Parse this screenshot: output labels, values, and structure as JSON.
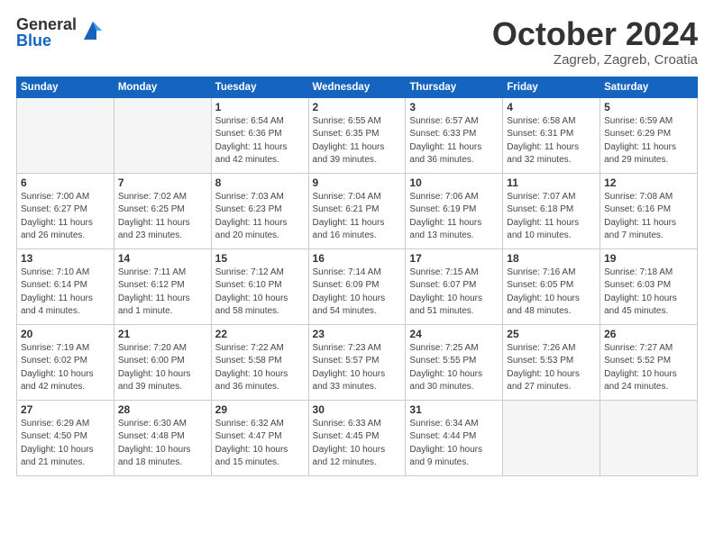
{
  "header": {
    "logo_general": "General",
    "logo_blue": "Blue",
    "month_title": "October 2024",
    "location": "Zagreb, Zagreb, Croatia"
  },
  "calendar": {
    "days_of_week": [
      "Sunday",
      "Monday",
      "Tuesday",
      "Wednesday",
      "Thursday",
      "Friday",
      "Saturday"
    ],
    "weeks": [
      [
        {
          "day": "",
          "info": ""
        },
        {
          "day": "",
          "info": ""
        },
        {
          "day": "1",
          "info": "Sunrise: 6:54 AM\nSunset: 6:36 PM\nDaylight: 11 hours\nand 42 minutes."
        },
        {
          "day": "2",
          "info": "Sunrise: 6:55 AM\nSunset: 6:35 PM\nDaylight: 11 hours\nand 39 minutes."
        },
        {
          "day": "3",
          "info": "Sunrise: 6:57 AM\nSunset: 6:33 PM\nDaylight: 11 hours\nand 36 minutes."
        },
        {
          "day": "4",
          "info": "Sunrise: 6:58 AM\nSunset: 6:31 PM\nDaylight: 11 hours\nand 32 minutes."
        },
        {
          "day": "5",
          "info": "Sunrise: 6:59 AM\nSunset: 6:29 PM\nDaylight: 11 hours\nand 29 minutes."
        }
      ],
      [
        {
          "day": "6",
          "info": "Sunrise: 7:00 AM\nSunset: 6:27 PM\nDaylight: 11 hours\nand 26 minutes."
        },
        {
          "day": "7",
          "info": "Sunrise: 7:02 AM\nSunset: 6:25 PM\nDaylight: 11 hours\nand 23 minutes."
        },
        {
          "day": "8",
          "info": "Sunrise: 7:03 AM\nSunset: 6:23 PM\nDaylight: 11 hours\nand 20 minutes."
        },
        {
          "day": "9",
          "info": "Sunrise: 7:04 AM\nSunset: 6:21 PM\nDaylight: 11 hours\nand 16 minutes."
        },
        {
          "day": "10",
          "info": "Sunrise: 7:06 AM\nSunset: 6:19 PM\nDaylight: 11 hours\nand 13 minutes."
        },
        {
          "day": "11",
          "info": "Sunrise: 7:07 AM\nSunset: 6:18 PM\nDaylight: 11 hours\nand 10 minutes."
        },
        {
          "day": "12",
          "info": "Sunrise: 7:08 AM\nSunset: 6:16 PM\nDaylight: 11 hours\nand 7 minutes."
        }
      ],
      [
        {
          "day": "13",
          "info": "Sunrise: 7:10 AM\nSunset: 6:14 PM\nDaylight: 11 hours\nand 4 minutes."
        },
        {
          "day": "14",
          "info": "Sunrise: 7:11 AM\nSunset: 6:12 PM\nDaylight: 11 hours\nand 1 minute."
        },
        {
          "day": "15",
          "info": "Sunrise: 7:12 AM\nSunset: 6:10 PM\nDaylight: 10 hours\nand 58 minutes."
        },
        {
          "day": "16",
          "info": "Sunrise: 7:14 AM\nSunset: 6:09 PM\nDaylight: 10 hours\nand 54 minutes."
        },
        {
          "day": "17",
          "info": "Sunrise: 7:15 AM\nSunset: 6:07 PM\nDaylight: 10 hours\nand 51 minutes."
        },
        {
          "day": "18",
          "info": "Sunrise: 7:16 AM\nSunset: 6:05 PM\nDaylight: 10 hours\nand 48 minutes."
        },
        {
          "day": "19",
          "info": "Sunrise: 7:18 AM\nSunset: 6:03 PM\nDaylight: 10 hours\nand 45 minutes."
        }
      ],
      [
        {
          "day": "20",
          "info": "Sunrise: 7:19 AM\nSunset: 6:02 PM\nDaylight: 10 hours\nand 42 minutes."
        },
        {
          "day": "21",
          "info": "Sunrise: 7:20 AM\nSunset: 6:00 PM\nDaylight: 10 hours\nand 39 minutes."
        },
        {
          "day": "22",
          "info": "Sunrise: 7:22 AM\nSunset: 5:58 PM\nDaylight: 10 hours\nand 36 minutes."
        },
        {
          "day": "23",
          "info": "Sunrise: 7:23 AM\nSunset: 5:57 PM\nDaylight: 10 hours\nand 33 minutes."
        },
        {
          "day": "24",
          "info": "Sunrise: 7:25 AM\nSunset: 5:55 PM\nDaylight: 10 hours\nand 30 minutes."
        },
        {
          "day": "25",
          "info": "Sunrise: 7:26 AM\nSunset: 5:53 PM\nDaylight: 10 hours\nand 27 minutes."
        },
        {
          "day": "26",
          "info": "Sunrise: 7:27 AM\nSunset: 5:52 PM\nDaylight: 10 hours\nand 24 minutes."
        }
      ],
      [
        {
          "day": "27",
          "info": "Sunrise: 6:29 AM\nSunset: 4:50 PM\nDaylight: 10 hours\nand 21 minutes."
        },
        {
          "day": "28",
          "info": "Sunrise: 6:30 AM\nSunset: 4:48 PM\nDaylight: 10 hours\nand 18 minutes."
        },
        {
          "day": "29",
          "info": "Sunrise: 6:32 AM\nSunset: 4:47 PM\nDaylight: 10 hours\nand 15 minutes."
        },
        {
          "day": "30",
          "info": "Sunrise: 6:33 AM\nSunset: 4:45 PM\nDaylight: 10 hours\nand 12 minutes."
        },
        {
          "day": "31",
          "info": "Sunrise: 6:34 AM\nSunset: 4:44 PM\nDaylight: 10 hours\nand 9 minutes."
        },
        {
          "day": "",
          "info": ""
        },
        {
          "day": "",
          "info": ""
        }
      ]
    ]
  }
}
